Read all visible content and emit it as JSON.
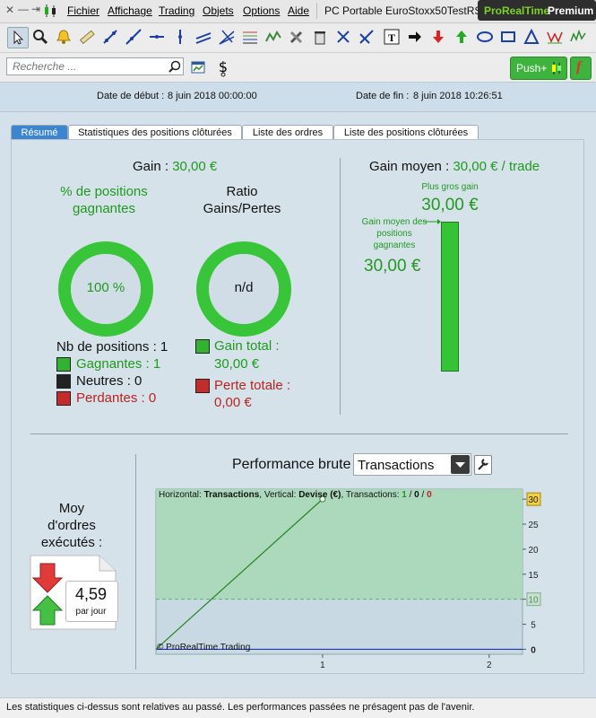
{
  "menubar": {
    "items": [
      "Fichier",
      "Affichage",
      "Trading",
      "Objets",
      "Options",
      "Aide"
    ],
    "window_title": "PC Portable EuroStoxx50TestRSI",
    "brand_pre": "ProRealTime",
    "brand_post": "Premium"
  },
  "toolbar": {
    "icons": [
      "cursor-icon",
      "magnifier-icon",
      "alarm-icon",
      "ruler-icon",
      "line-icon",
      "trend-icon",
      "horizontal-line-icon",
      "vertical-line-icon",
      "channel-icon",
      "fan-icon",
      "fibonacci-icon",
      "zigzag-icon",
      "tools-icon",
      "trash-icon",
      "cross-icon",
      "double-line-icon",
      "text-icon",
      "arrow-right-icon",
      "arrow-down-icon",
      "arrow-up-icon",
      "ellipse-icon",
      "rectangle-icon",
      "triangle-icon",
      "pattern-icon",
      "wave-icon"
    ]
  },
  "search": {
    "placeholder": "Recherche ..."
  },
  "push": {
    "label": "Push+"
  },
  "dates": {
    "start_label": "Date de début : ",
    "start_value": "8 juin 2018 00:00:00",
    "end_label": "Date de fin : ",
    "end_value": "8 juin 2018 10:26:51"
  },
  "tabs": [
    "Résumé",
    "Statistiques des positions clôturées",
    "Liste des ordres",
    "Liste des positions clôturées"
  ],
  "summary": {
    "gain_label": "Gain : ",
    "gain_value": "30,00 €",
    "winpct_title": "% de positions gagnantes",
    "winpct_value": "100 %",
    "ratio_title": "Ratio Gains/Pertes",
    "ratio_value": "n/d",
    "nb_positions": "Nb de positions : 1",
    "gagnantes": "Gagnantes : 1",
    "neutres": "Neutres : 0",
    "perdantes": "Perdantes : 0",
    "gain_total_label": "Gain total :",
    "gain_total_value": "30,00 €",
    "perte_totale_label": "Perte totale :",
    "perte_totale_value": "0,00 €",
    "gain_moyen_label": "Gain moyen : ",
    "gain_moyen_value": "30,00 € / trade",
    "plus_gros_gain_label": "Plus gros gain",
    "plus_gros_gain_value": "30,00 €",
    "gain_moyen_pos_label": "Gain moyen des positions gagnantes",
    "gain_moyen_pos_value": "30,00 €"
  },
  "orders": {
    "title": "Moy d'ordres exécutés :",
    "value": "4,59",
    "unit": "par jour"
  },
  "performance": {
    "title": "Performance brute",
    "select_value": "Transactions",
    "info_horizontal": "Horizontal: ",
    "info_h_value": "Transactions",
    "info_vertical": ", Vertical: ",
    "info_v_value": "Devise (€)",
    "info_transactions": ", Transactions: ",
    "info_t1": "1",
    "info_sep1": " / ",
    "info_t2": "0",
    "info_sep2": " / ",
    "info_t3": "0",
    "copyright": "© ProRealTime Trading"
  },
  "chart_data": {
    "type": "line",
    "x": [
      0,
      1
    ],
    "y": [
      0,
      30
    ],
    "xlim": [
      0,
      2.2
    ],
    "ylim": [
      -1,
      32
    ],
    "x_ticks": [
      1,
      2
    ],
    "y_ticks": [
      0,
      5,
      10,
      15,
      20,
      25,
      30
    ],
    "highlight_ticks": [
      30,
      10
    ],
    "threshold_line": 10,
    "zero_line": 0,
    "colors": {
      "line": "#2a8a2a",
      "fill": "#a9d8b7",
      "zero": "#2233aa"
    }
  },
  "footer": {
    "text": "Les statistiques ci-dessus sont relatives au passé. Les performances passées ne présagent pas de l'avenir."
  }
}
